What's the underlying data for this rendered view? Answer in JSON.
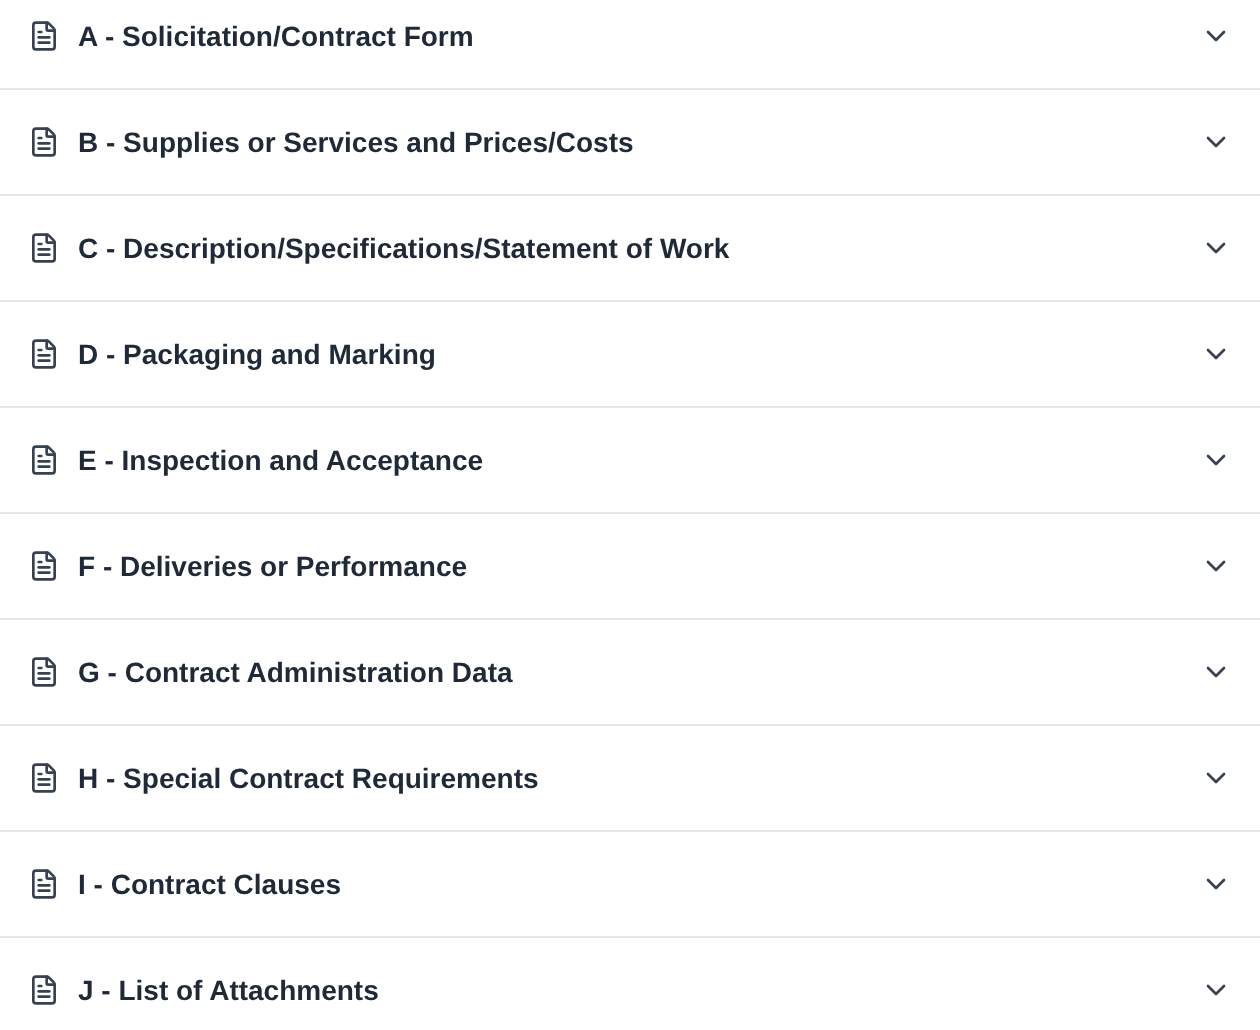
{
  "sections": [
    {
      "label": "A - Solicitation/Contract Form",
      "expanded": false
    },
    {
      "label": "B - Supplies or Services and Prices/Costs",
      "expanded": false
    },
    {
      "label": "C - Description/Specifications/Statement of Work",
      "expanded": false
    },
    {
      "label": "D - Packaging and Marking",
      "expanded": false
    },
    {
      "label": "E - Inspection and Acceptance",
      "expanded": false
    },
    {
      "label": "F - Deliveries or Performance",
      "expanded": false
    },
    {
      "label": "G - Contract Administration Data",
      "expanded": false
    },
    {
      "label": "H - Special Contract Requirements",
      "expanded": false
    },
    {
      "label": "I - Contract Clauses",
      "expanded": false
    },
    {
      "label": "J - List of Attachments",
      "expanded": false
    }
  ]
}
